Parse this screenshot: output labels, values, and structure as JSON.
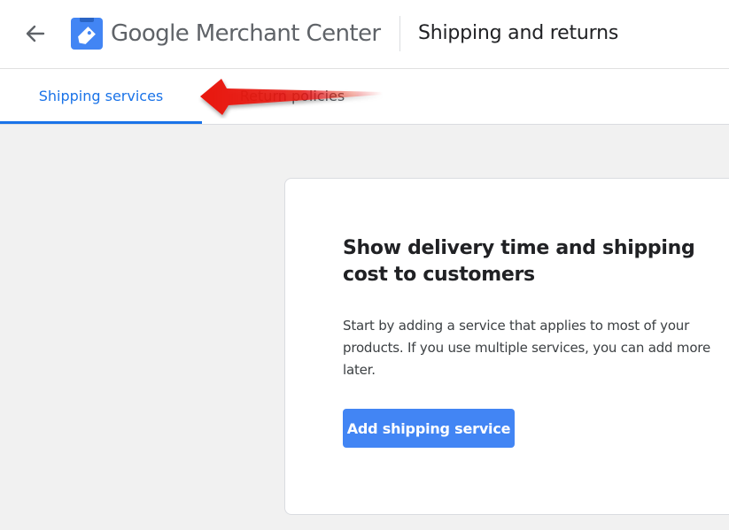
{
  "header": {
    "brand": "Google Merchant Center",
    "title": "Shipping and returns",
    "back_icon": "arrow-left-icon",
    "logo_icon": "merchant-center-tag-icon"
  },
  "tabs": [
    {
      "label": "Shipping services",
      "active": true
    },
    {
      "label": "Return policies",
      "active": false
    }
  ],
  "card": {
    "heading": "Show delivery time and shipping cost to customers",
    "body": "Start by adding a service that applies to most of your products. If you use multiple services, you can add more later.",
    "button_label": "Add shipping service"
  },
  "colors": {
    "accent": "#1a73e8",
    "button": "#4285f4",
    "annotation": "#e8140c",
    "background": "#f1f1f1"
  }
}
